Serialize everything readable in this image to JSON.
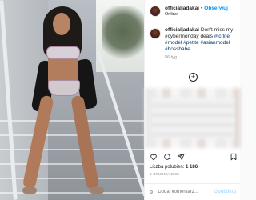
{
  "header": {
    "username": "officialjadakai",
    "separator": "•",
    "follow_label": "Obserwuj",
    "location": "Online"
  },
  "caption": {
    "username": "officialjadakai",
    "text": "Don't miss my #cybermonday deals",
    "hashtags": "#tcrlife #model #petite #asianmodel #bossbabe",
    "time": "56 tyg."
  },
  "actions": {
    "like_icon": "heart-icon",
    "comment_icon": "comment-icon",
    "share_icon": "share-icon",
    "save_icon": "bookmark-icon"
  },
  "likes": {
    "label": "Liczba polubień:",
    "count": "1 186"
  },
  "date": "3 GRUDNIA 2018",
  "comment": {
    "placeholder": "Dodaj komentarz...",
    "publish_label": "Opublikuj"
  },
  "colors": {
    "link": "#0095f6",
    "hashtag": "#00376b",
    "muted": "#8e8e8e"
  }
}
